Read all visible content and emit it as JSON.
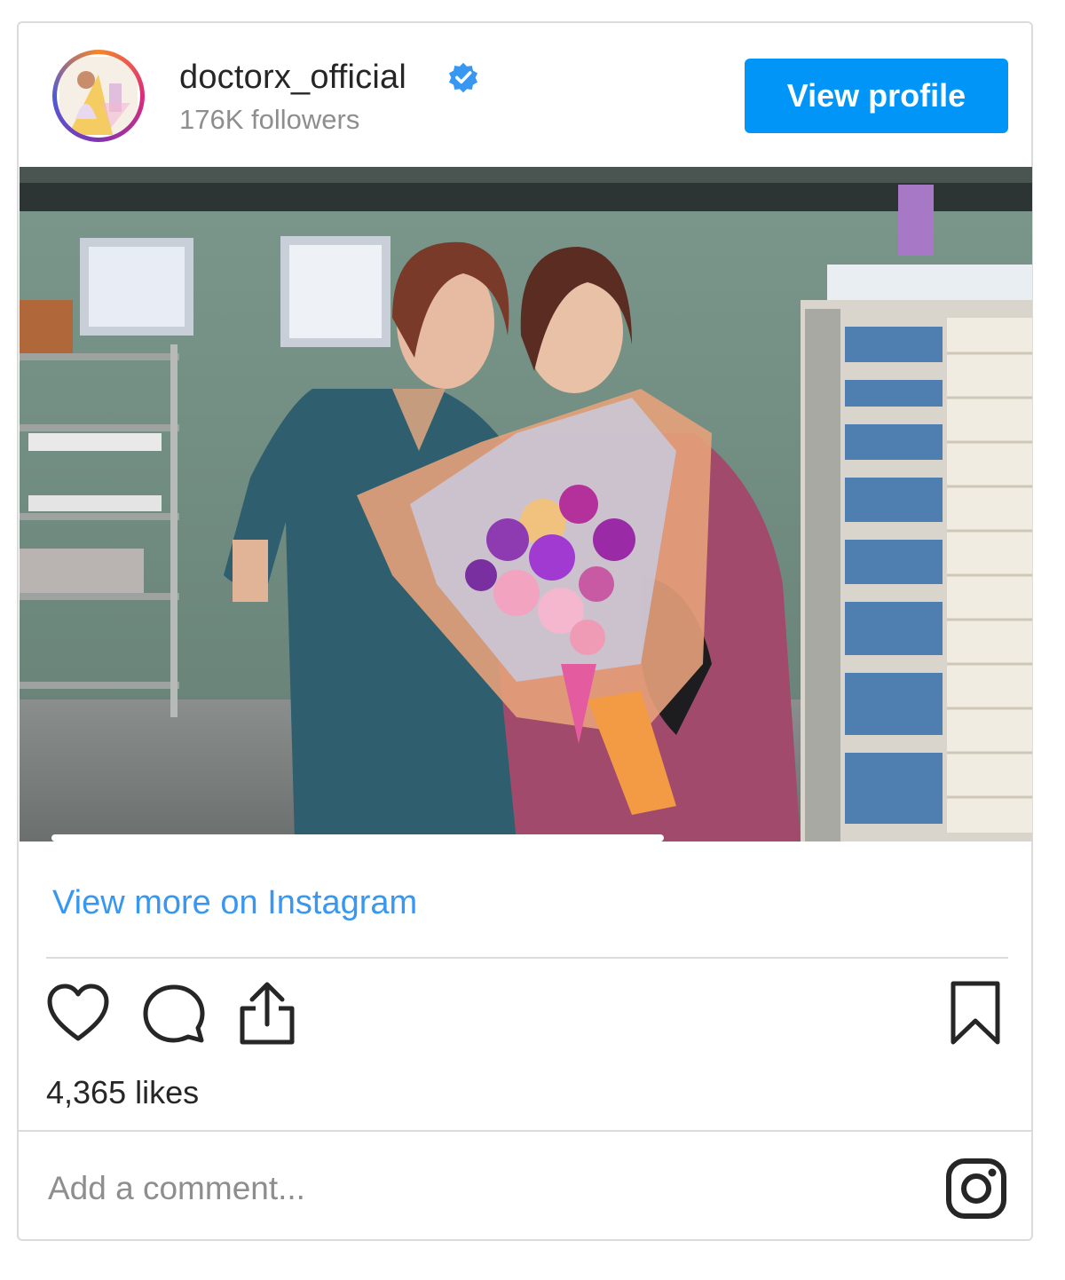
{
  "header": {
    "username": "doctorx_official",
    "followers": "176K followers",
    "view_profile_label": "View profile",
    "verified": true,
    "avatar_icon": "profile-avatar"
  },
  "post": {
    "image_alt": "Two women in scrubs posing with a bouquet of flowers in a hospital room",
    "view_more_label": "View more on Instagram",
    "likes": "4,365 likes"
  },
  "actions": {
    "like_icon": "heart-icon",
    "comment_icon": "comment-icon",
    "share_icon": "share-icon",
    "save_icon": "bookmark-icon"
  },
  "comment": {
    "placeholder": "Add a comment..."
  },
  "footer": {
    "logo_icon": "instagram-icon"
  },
  "colors": {
    "accent": "#0095f6",
    "link": "#3897f0",
    "text": "#262626",
    "muted": "#8e8e8e",
    "border": "#dbdbdb"
  }
}
